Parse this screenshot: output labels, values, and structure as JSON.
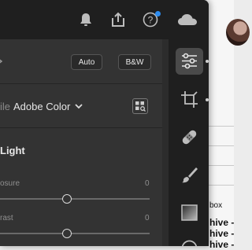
{
  "toolbar": {
    "icons": [
      "bell-icon",
      "share-icon",
      "help-icon",
      "cloud-icon"
    ],
    "help_glyph": "?",
    "notification_color": "#2d8cf0"
  },
  "edit_panel": {
    "auto_label": "Auto",
    "bw_label": "B&W",
    "profile": {
      "label": "ile",
      "value": "Adobe Color"
    },
    "light_section": {
      "title": "Light",
      "sliders": [
        {
          "label": "osure",
          "value": "0",
          "level": 0.5
        },
        {
          "label": "rast",
          "value": "0",
          "level": 0.5
        }
      ]
    }
  },
  "right_rail": {
    "tools": [
      "edit-sliders-icon",
      "crop-icon",
      "healing-icon",
      "brush-icon",
      "gradient-icon"
    ],
    "active_tool": "edit-sliders-icon"
  },
  "background_page": {
    "label": "box",
    "rows": [
      "hive -",
      "hive -",
      "hive -"
    ]
  }
}
